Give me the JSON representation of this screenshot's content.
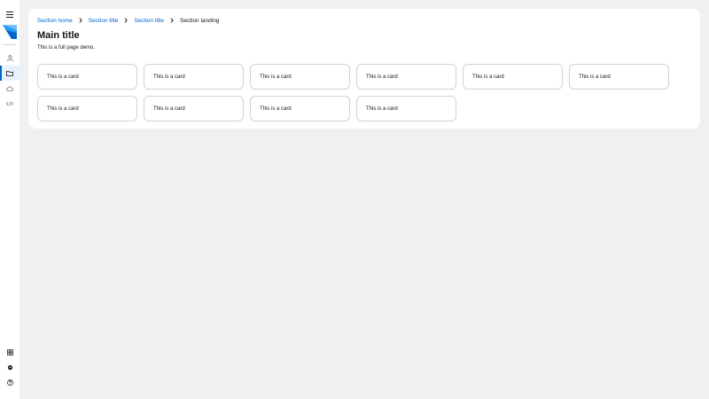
{
  "sidebar": {
    "menu_icon": "hamburger-menu-icon",
    "logo": "brand-logo",
    "nav_items": [
      {
        "icon": "user-icon",
        "active": false
      },
      {
        "icon": "folder-icon",
        "active": true
      },
      {
        "icon": "cloud-icon",
        "active": false
      },
      {
        "icon": "code-icon",
        "active": false
      }
    ],
    "footer_items": [
      {
        "icon": "grid-icon"
      },
      {
        "icon": "gear-icon"
      },
      {
        "icon": "help-icon"
      }
    ],
    "accent_color": "#0066cc"
  },
  "breadcrumb": {
    "items": [
      "Section home",
      "Section title",
      "Section title"
    ],
    "current": "Section landing"
  },
  "page": {
    "title": "Main title",
    "description": "This is a full page demo."
  },
  "cards": [
    {
      "label": "This is a card"
    },
    {
      "label": "This is a card"
    },
    {
      "label": "This is a card"
    },
    {
      "label": "This is a card"
    },
    {
      "label": "This is a card"
    },
    {
      "label": "This is a card"
    },
    {
      "label": "This is a card"
    },
    {
      "label": "This is a card"
    },
    {
      "label": "This is a card"
    },
    {
      "label": "This is a card"
    }
  ]
}
